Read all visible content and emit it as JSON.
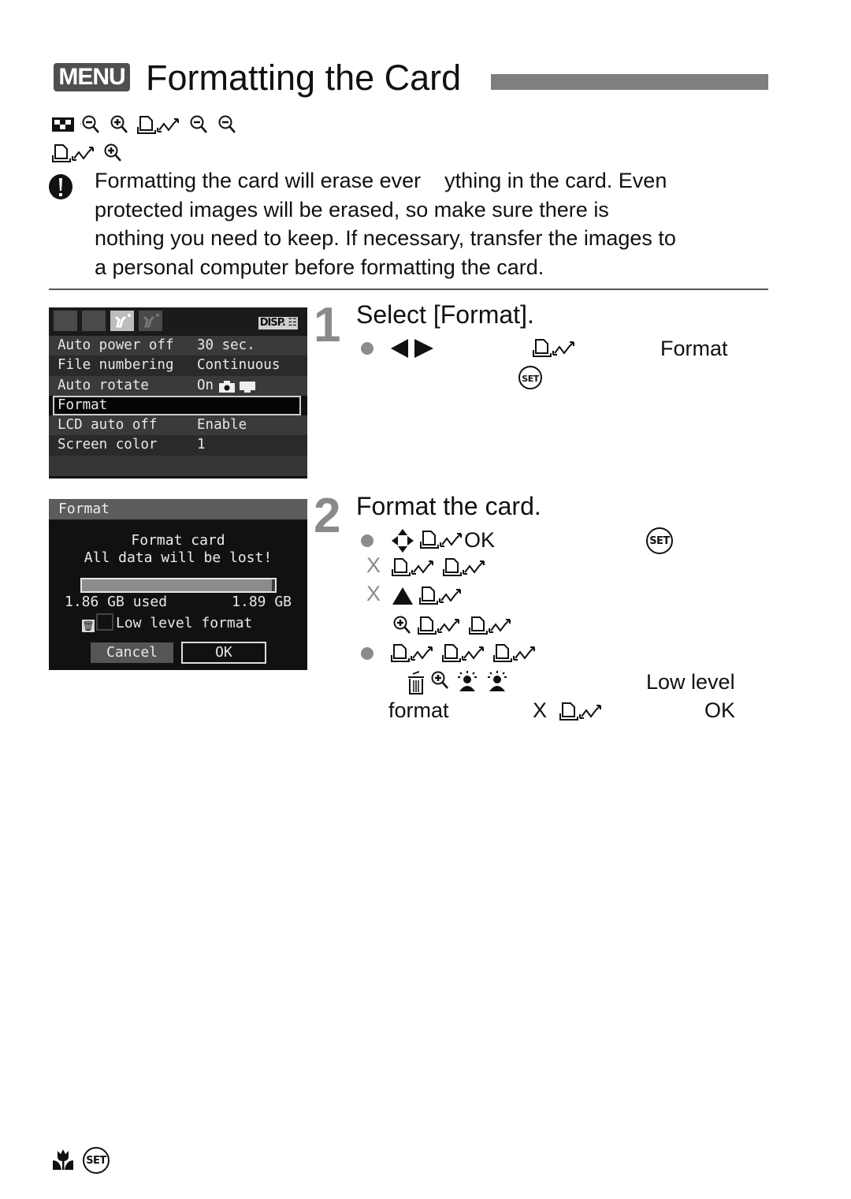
{
  "header": {
    "menu_badge": "MENU",
    "title": "Formatting the Card"
  },
  "garbled_lines": [
    [
      "checker-icon",
      "zoom-out-icon",
      "zoom-in-icon",
      "print-share-icon",
      "zoom-out-icon",
      "zoom-out-icon"
    ],
    [
      "print-share-icon",
      "zoom-in-icon"
    ]
  ],
  "caution": {
    "lines": [
      [
        "Formatting the card will erase ever",
        "ything in the card. Even"
      ],
      "protected images will be erased, so make sure there is",
      "nothing you need to keep. If necessary, transfer the images to",
      "a personal computer before formatting the card."
    ]
  },
  "screen1": {
    "tabs": [
      "shooting-menu-1",
      "shooting-menu-2",
      "setup-menu-1",
      "setup-menu-2"
    ],
    "active_tab": 2,
    "disp_label": "DISP.",
    "rows": [
      {
        "label": "Auto power off",
        "value": "30 sec."
      },
      {
        "label": "File numbering",
        "value": "Continuous"
      },
      {
        "label": "Auto rotate",
        "value": "On"
      },
      {
        "label": "Format",
        "value": "",
        "selected": true
      },
      {
        "label": "LCD auto off",
        "value": "Enable"
      },
      {
        "label": "Screen color",
        "value": "1"
      }
    ]
  },
  "screen2": {
    "header": "Format",
    "line1": "Format card",
    "line2": "All data will be lost!",
    "used_label": "1.86 GB used",
    "total_label": "1.89 GB",
    "used_fraction": 0.984,
    "low_level_label": "Low level format",
    "low_level_checked": false,
    "cancel_label": "Cancel",
    "ok_label": "OK"
  },
  "steps": [
    {
      "number": "1",
      "title": "Select [Format].",
      "line1_word": "Format"
    },
    {
      "number": "2",
      "title": "Format the card.",
      "line1_word": "OK",
      "x_mark": "X",
      "low_level_word": "Low level",
      "format_word": "format",
      "ok_word": "OK"
    }
  ],
  "footer": {
    "icons": [
      "macro-icon",
      "set-button-icon"
    ],
    "set_label": "SET"
  },
  "icons": {
    "set_label": "SET"
  }
}
